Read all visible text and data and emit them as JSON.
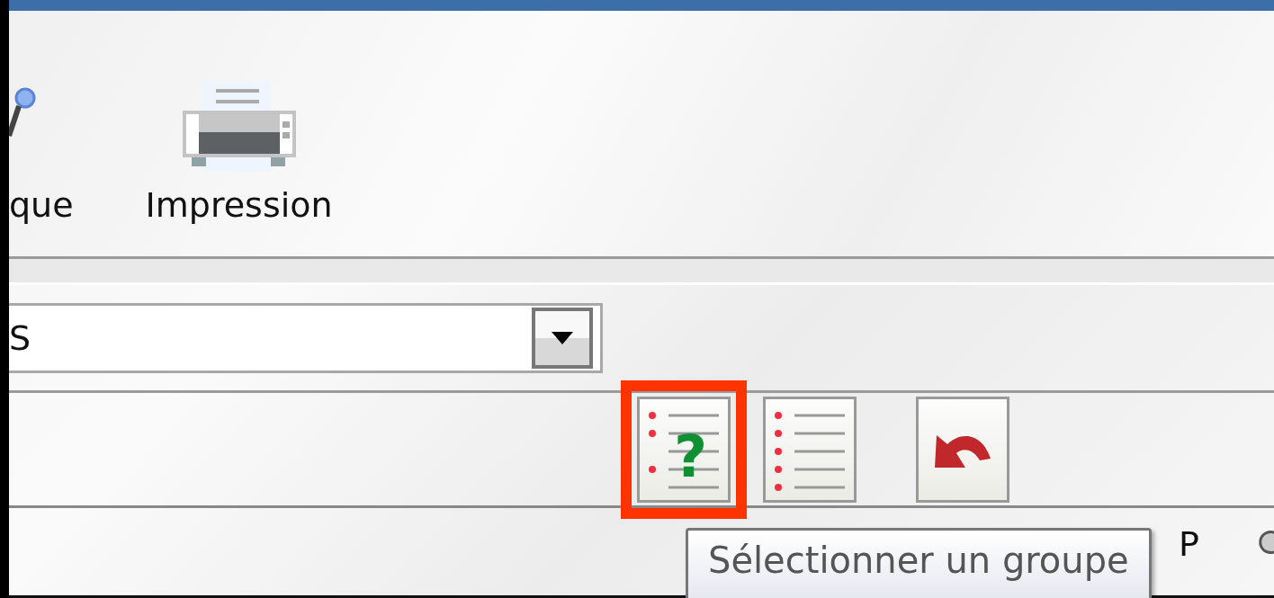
{
  "ribbon": {
    "buttons": [
      {
        "kind": "search",
        "label": "que"
      },
      {
        "kind": "printer",
        "label": "Impression"
      }
    ]
  },
  "dropdown": {
    "value": "S"
  },
  "toolbar": {
    "buttons": [
      {
        "kind": "select-group",
        "highlighted": true,
        "symbol": "?"
      },
      {
        "kind": "list",
        "highlighted": false
      },
      {
        "kind": "undo",
        "highlighted": false
      }
    ]
  },
  "tooltip": {
    "text": "Sélectionner un groupe"
  },
  "bottom_bar": {
    "items": [
      "P"
    ]
  }
}
